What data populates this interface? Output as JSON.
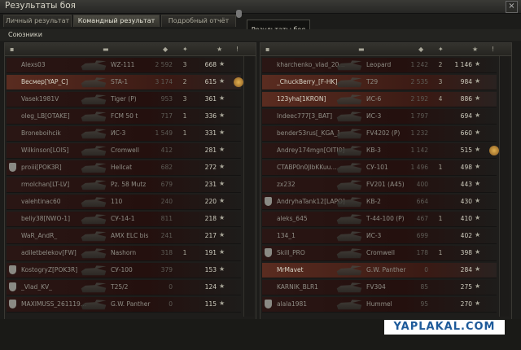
{
  "window": {
    "title": "Результаты боя"
  },
  "tabs": [
    {
      "label": "Личный результат"
    },
    {
      "label": "Командный результат"
    },
    {
      "label": "Подробный отчёт"
    }
  ],
  "tooltip": "Результаты боя",
  "section_title": "Союзники",
  "left_rows": [
    {
      "player": "Alexs03",
      "tank": "WZ-111",
      "dmg": "2 592",
      "kills": "3",
      "xp": "668"
    },
    {
      "player": "Весмер[YAP_C]",
      "tank": "STA-1",
      "dmg": "3 174",
      "kills": "2",
      "xp": "615",
      "me": true,
      "medal": true
    },
    {
      "player": "Vasek1981V",
      "tank": "Tiger (P)",
      "dmg": "953",
      "kills": "3",
      "xp": "361"
    },
    {
      "player": "oleg_LB[OTAKE]",
      "tank": "FCM 50 t",
      "dmg": "717",
      "kills": "1",
      "xp": "336"
    },
    {
      "player": "Broneboihcik",
      "tank": "ИС-3",
      "dmg": "1 549",
      "kills": "1",
      "xp": "331"
    },
    {
      "player": "Wilkinson[LOIS]",
      "tank": "Cromwell",
      "dmg": "412",
      "kills": "",
      "xp": "281"
    },
    {
      "player": "proiii[POK3R]",
      "tank": "Hellcat",
      "dmg": "682",
      "kills": "",
      "xp": "272",
      "shield": true
    },
    {
      "player": "rmolchan[LT-LV]",
      "tank": "Pz. 58 Mutz",
      "dmg": "679",
      "kills": "",
      "xp": "231"
    },
    {
      "player": "valehtinac60",
      "tank": "110",
      "dmg": "240",
      "kills": "",
      "xp": "220"
    },
    {
      "player": "beliy38[NWO-1]",
      "tank": "СУ-14-1",
      "dmg": "811",
      "kills": "",
      "xp": "218"
    },
    {
      "player": "WaR_AndR_",
      "tank": "AMX ELC bis",
      "dmg": "241",
      "kills": "",
      "xp": "217"
    },
    {
      "player": "adiletbelekov[FW]",
      "tank": "Nashorn",
      "dmg": "318",
      "kills": "1",
      "xp": "191"
    },
    {
      "player": "KostogryZ[POK3R]",
      "tank": "СУ-100",
      "dmg": "379",
      "kills": "",
      "xp": "153",
      "shield": true
    },
    {
      "player": "_Vlad_KV_",
      "tank": "T25/2",
      "dmg": "0",
      "kills": "",
      "xp": "124",
      "shield": true
    },
    {
      "player": "MAXIMUSS_261119...",
      "tank": "G.W. Panther",
      "dmg": "0",
      "kills": "",
      "xp": "115",
      "shield": true
    }
  ],
  "right_rows": [
    {
      "player": "kharchenko_vlad_20...",
      "tank": "Leopard",
      "dmg": "1 242",
      "kills": "2",
      "xp": "1 146"
    },
    {
      "player": "_ChuckBerry_[F-HK]",
      "tank": "T29",
      "dmg": "2 535",
      "kills": "3",
      "xp": "984",
      "me": true
    },
    {
      "player": "123yha[1KRON]",
      "tank": "ИС-6",
      "dmg": "2 192",
      "kills": "4",
      "xp": "886",
      "me": true
    },
    {
      "player": "Indeec777[3_BAT]",
      "tank": "ИС-3",
      "dmg": "1 797",
      "kills": "",
      "xp": "694"
    },
    {
      "player": "bender53rus[_KGA_]",
      "tank": "FV4202 (P)",
      "dmg": "1 232",
      "kills": "",
      "xp": "660"
    },
    {
      "player": "Andrey174mgn[OITI0]",
      "tank": "КВ-3",
      "dmg": "1 142",
      "kills": "",
      "xp": "515",
      "medal": true
    },
    {
      "player": "CTABP0n0JlbKKuu...",
      "tank": "СУ-101",
      "dmg": "1 496",
      "kills": "1",
      "xp": "498"
    },
    {
      "player": "zx232",
      "tank": "FV201 (A45)",
      "dmg": "400",
      "kills": "",
      "xp": "443"
    },
    {
      "player": "AndryhaTank12[LAPO]",
      "tank": "КВ-2",
      "dmg": "664",
      "kills": "",
      "xp": "430",
      "shield": true
    },
    {
      "player": "aleks_645",
      "tank": "Т-44-100 (Р)",
      "dmg": "467",
      "kills": "1",
      "xp": "410"
    },
    {
      "player": "134_1",
      "tank": "ИС-3",
      "dmg": "699",
      "kills": "",
      "xp": "402"
    },
    {
      "player": "Skill_PRO",
      "tank": "Cromwell",
      "dmg": "178",
      "kills": "1",
      "xp": "398",
      "shield": true
    },
    {
      "player": "MrMavet",
      "tank": "G.W. Panther",
      "dmg": "0",
      "kills": "",
      "xp": "284",
      "me": true
    },
    {
      "player": "KARNIK_BLR1",
      "tank": "FV304",
      "dmg": "85",
      "kills": "",
      "xp": "275"
    },
    {
      "player": "alala1981",
      "tank": "Hummel",
      "dmg": "95",
      "kills": "",
      "xp": "270",
      "shield": true
    }
  ],
  "watermark": "YAPLAKAL.COM",
  "icons": {
    "star": "★",
    "close": "×"
  }
}
